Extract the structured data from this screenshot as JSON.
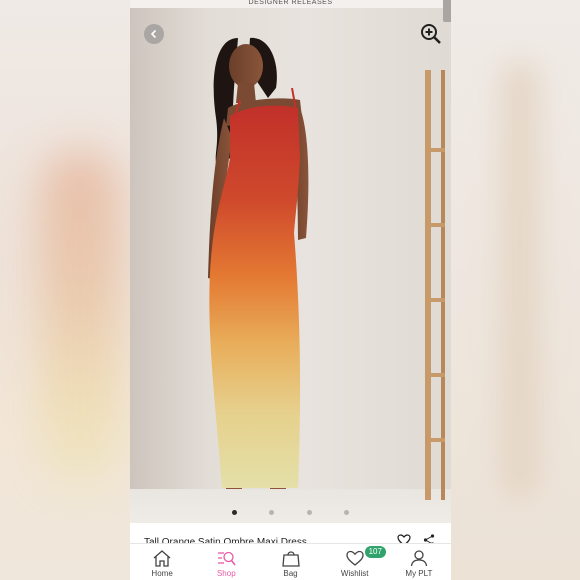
{
  "top_status_text": "DESIGNER RELEASES",
  "product": {
    "name": "Tall Orange Satin Ombre Maxi Dress",
    "image_count": 4,
    "active_image": 1
  },
  "controls": {
    "back_icon": "chevron-left-icon",
    "zoom_icon": "zoom-in-icon",
    "wishlist_icon": "heart-icon",
    "share_icon": "share-icon"
  },
  "tabs": [
    {
      "label": "Home",
      "icon": "home-icon",
      "active": false
    },
    {
      "label": "Shop",
      "icon": "shop-search-icon",
      "active": true
    },
    {
      "label": "Bag",
      "icon": "bag-icon",
      "active": false
    },
    {
      "label": "Wishlist",
      "icon": "wishlist-heart-icon",
      "active": false,
      "badge": "107"
    },
    {
      "label": "My PLT",
      "icon": "user-icon",
      "active": false
    }
  ],
  "colors": {
    "accent_pink": "#e85aa5",
    "badge_green": "#2fa36b",
    "dress_top": "#c8382c",
    "dress_mid": "#e38a3b",
    "dress_bottom": "#e2dc9a"
  }
}
